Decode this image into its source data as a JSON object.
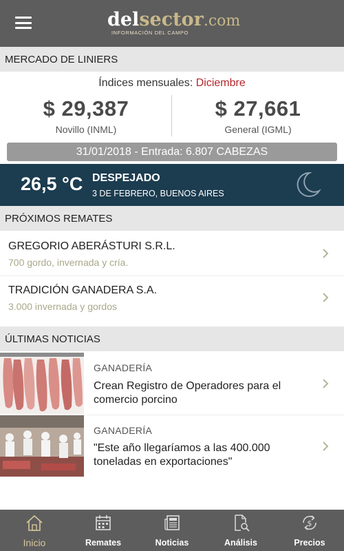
{
  "header": {
    "logo_del": "del",
    "logo_sector": "sector",
    "logo_com": ".com",
    "logo_tagline": "INFORMACIÓN DEL CAMPO"
  },
  "market": {
    "section_title": "MERCADO DE LINIERS",
    "indices_label": "Índices mensuales:",
    "indices_month": "Diciembre",
    "novillo_value": "$ 29,387",
    "novillo_label": "Novillo (INML)",
    "general_value": "$ 27,661",
    "general_label": "General (IGML)",
    "entry_text": "31/01/2018 - Entrada: 6.807 CABEZAS"
  },
  "weather": {
    "temperature": "26,5 °C",
    "condition": "DESPEJADO",
    "date_location": "3 DE FEBRERO, BUENOS AIRES",
    "icon": "moon-icon"
  },
  "remates": {
    "section_title": "PRÓXIMOS REMATES",
    "items": [
      {
        "title": "GREGORIO ABERÁSTURI S.R.L.",
        "subtitle": "700 gordo, invernada y cría."
      },
      {
        "title": "TRADICIÓN GANADERA S.A.",
        "subtitle": "3.000 invernada y gordos"
      }
    ]
  },
  "news": {
    "section_title": "ÚLTIMAS NOTICIAS",
    "items": [
      {
        "category": "GANADERÍA",
        "title": "Crean Registro de Operadores para el comercio porcino"
      },
      {
        "category": "GANADERÍA",
        "title": "\"Este año llegaríamos a las 400.000 toneladas en exportaciones\""
      }
    ]
  },
  "nav": {
    "items": [
      {
        "label": "Inicio",
        "icon": "home-icon"
      },
      {
        "label": "Remates",
        "icon": "calendar-icon"
      },
      {
        "label": "Noticias",
        "icon": "newspaper-icon"
      },
      {
        "label": "Análisis",
        "icon": "document-search-icon"
      },
      {
        "label": "Precios",
        "icon": "dollar-cycle-icon"
      }
    ]
  },
  "colors": {
    "topbar": "#5d5d5d",
    "brand_gold": "#c8b88a",
    "accent_red": "#b3262c",
    "weather_bg": "#1c3c50",
    "section_header_bg": "#e6e6e6"
  }
}
